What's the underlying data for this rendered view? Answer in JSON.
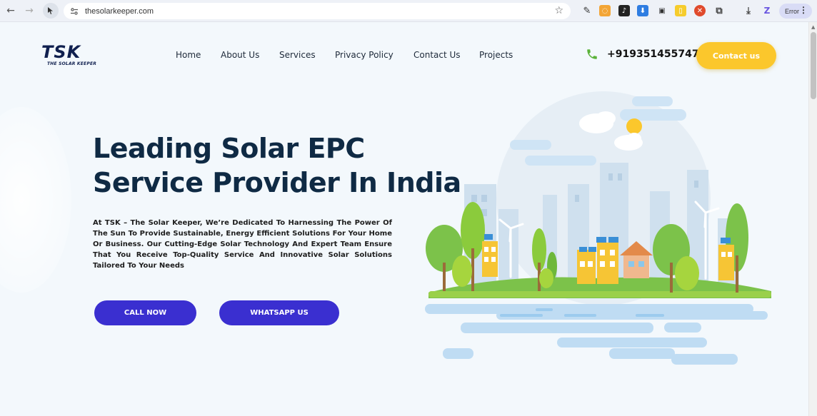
{
  "browser": {
    "url": "thesolarkeeper.com",
    "error_label": "Error"
  },
  "site": {
    "logo": {
      "letters": "TSK",
      "tagline": "THE SOLAR KEEPER"
    },
    "nav": [
      "Home",
      "About Us",
      "Services",
      "Privacy Policy",
      "Contact Us",
      "Projects"
    ],
    "phone": "+919351455747",
    "contact_button": "Contact us"
  },
  "hero": {
    "title_line1": "Leading Solar EPC",
    "title_line2": "Service Provider In India",
    "description": "At TSK – The Solar Keeper, We’re Dedicated To Harnessing The Power Of The Sun To Provide Sustainable, Energy Efficient Solutions For Your Home Or Business. Our Cutting-Edge Solar Technology And Expert Team Ensure That You Receive Top-Quality Service And Innovative Solar Solutions Tailored To Your Needs",
    "call_button": "CALL NOW",
    "whatsapp_button": "WHATSAPP US"
  },
  "colors": {
    "brand_dark": "#0f2a44",
    "cta_blue": "#3a2fd0",
    "contact_yellow": "#fbc72c",
    "phone_green": "#5bb23a"
  }
}
